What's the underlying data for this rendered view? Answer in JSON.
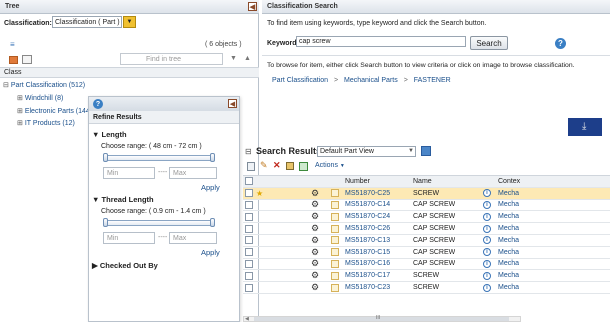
{
  "tree_panel": {
    "title": "Tree",
    "classification_label": "Classification:",
    "classification_value": "Classification ( Part )",
    "objects_count": "( 6 objects )",
    "find_placeholder": "Find in tree",
    "column_header": "Class",
    "nodes": [
      {
        "label": "Part Classification (512)"
      },
      {
        "label": "Windchill (8)"
      },
      {
        "label": "Electronic Parts (144)"
      },
      {
        "label": "IT Products (12)"
      }
    ]
  },
  "classification_search": {
    "title": "Classification Search",
    "instruction": "To find item using keywords, type keyword and click the Search button.",
    "keyword_label": "Keyword:",
    "keyword_value": "cap screw",
    "search_button": "Search",
    "browse_instruction": "To browse for item, either click Search button to view criteria or click on image to browse classification.",
    "breadcrumb": [
      "Part Classification",
      "Mechanical Parts",
      "FASTENER"
    ],
    "breadcrumb_sep": ">"
  },
  "refine": {
    "title": "Refine Results",
    "sections": [
      {
        "title": "Length",
        "range_label": "Choose range: ( 48 cm - 72 cm )",
        "min_placeholder": "Min",
        "max_placeholder": "Max",
        "sep": "----",
        "apply": "Apply"
      },
      {
        "title": "Thread Length",
        "range_label": "Choose range: ( 0.9 cm - 1.4 cm )",
        "min_placeholder": "Min",
        "max_placeholder": "Max",
        "sep": "----",
        "apply": "Apply"
      }
    ],
    "collapsed_section": "Checked Out By"
  },
  "results": {
    "title": "Search Results",
    "view_select": "Default Part View",
    "actions_label": "Actions",
    "columns": {
      "number": "Number",
      "name": "Name",
      "context": "Contex"
    },
    "rows": [
      {
        "number": "MS51870-C25",
        "name": "SCREW",
        "context": "Mecha",
        "selected": true
      },
      {
        "number": "MS51870-C14",
        "name": "CAP SCREW",
        "context": "Mecha",
        "selected": false
      },
      {
        "number": "MS51870-C24",
        "name": "CAP SCREW",
        "context": "Mecha",
        "selected": false
      },
      {
        "number": "MS51870-C26",
        "name": "CAP SCREW",
        "context": "Mecha",
        "selected": false
      },
      {
        "number": "MS51870-C13",
        "name": "CAP SCREW",
        "context": "Mecha",
        "selected": false
      },
      {
        "number": "MS51870-C15",
        "name": "CAP SCREW",
        "context": "Mecha",
        "selected": false
      },
      {
        "number": "MS51870-C16",
        "name": "CAP SCREW",
        "context": "Mecha",
        "selected": false
      },
      {
        "number": "MS51870-C17",
        "name": "SCREW",
        "context": "Mecha",
        "selected": false
      },
      {
        "number": "MS51870-C23",
        "name": "SCREW",
        "context": "Mecha",
        "selected": false
      }
    ],
    "scroll_marker": "III"
  },
  "colors": {
    "header_bg": "#dde3ea",
    "selected_row": "#fde9b4",
    "link": "#1a4f8b",
    "dark_tile": "#1d3e8a",
    "dropdown": "#f0c030"
  }
}
